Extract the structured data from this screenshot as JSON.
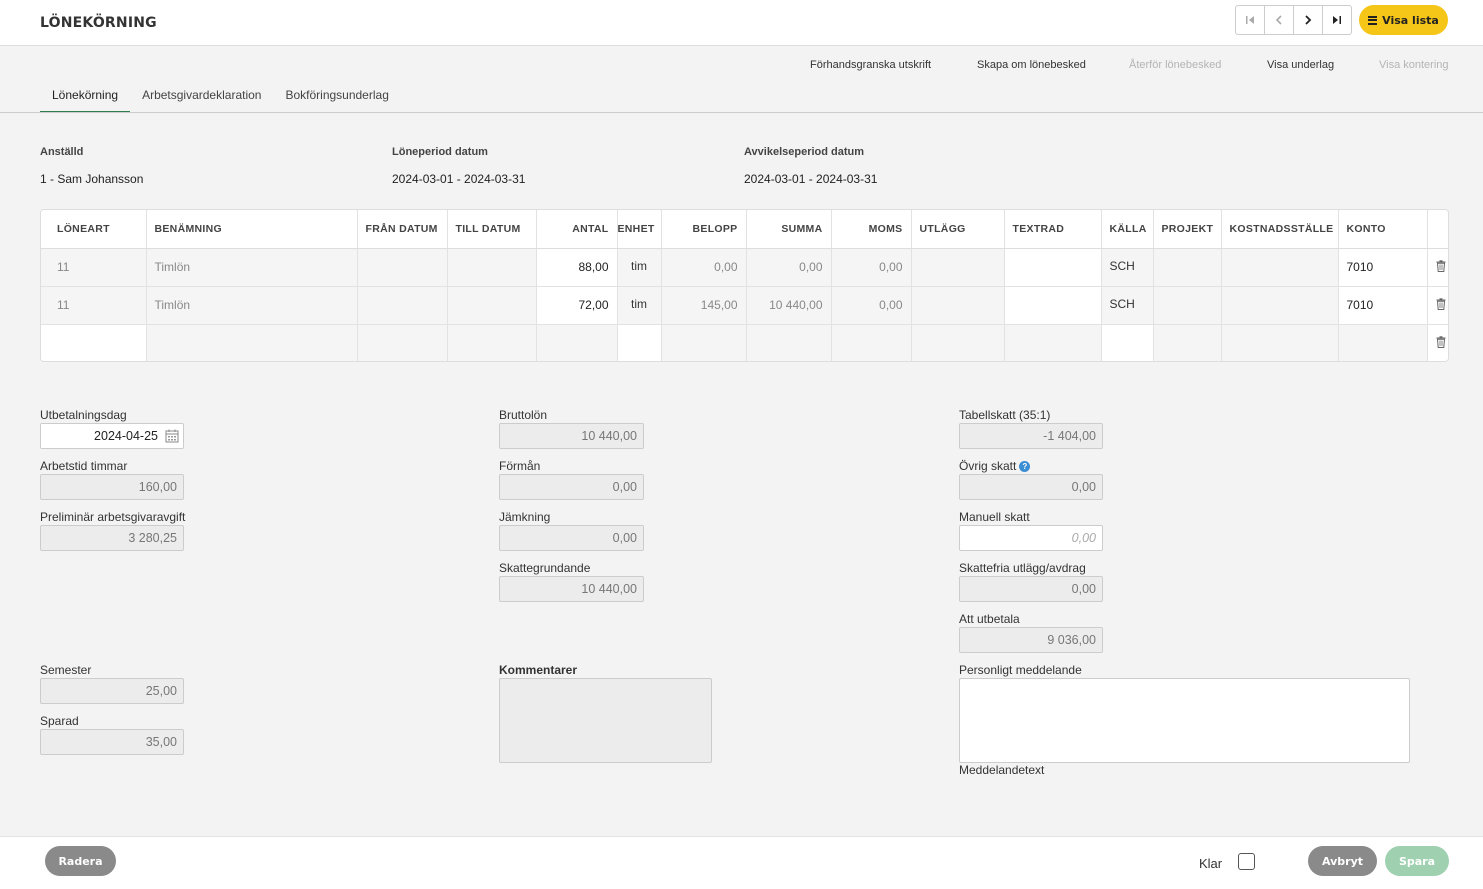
{
  "header": {
    "title": "LÖNEKÖRNING",
    "visa_lista": "Visa lista"
  },
  "actions": {
    "preview": "Förhandsgranska utskrift",
    "recreate": "Skapa om lönebesked",
    "revert": "Återför lönebesked",
    "show_basis": "Visa underlag",
    "show_posting": "Visa kontering"
  },
  "tabs": [
    "Lönekörning",
    "Arbetsgivardeklaration",
    "Bokföringsunderlag"
  ],
  "info": {
    "employee_label": "Anställd",
    "employee_value": "1 - Sam Johansson",
    "period_label": "Löneperiod datum",
    "period_value": "2024-03-01 - 2024-03-31",
    "deviation_label": "Avvikelseperiod datum",
    "deviation_value": "2024-03-01 - 2024-03-31"
  },
  "grid": {
    "headers": [
      "LÖNEART",
      "BENÄMNING",
      "FRÅN DATUM",
      "TILL DATUM",
      "ANTAL",
      "ENHET",
      "BELOPP",
      "SUMMA",
      "MOMS",
      "UTLÄGG",
      "TEXTRAD",
      "KÄLLA",
      "PROJEKT",
      "KOSTNADSSTÄLLE",
      "KONTO"
    ],
    "rows": [
      {
        "loneart": "11",
        "benamning": "Timlön",
        "fran": "",
        "till": "",
        "antal": "88,00",
        "enhet": "tim",
        "belopp": "0,00",
        "summa": "0,00",
        "moms": "0,00",
        "utlagg": "",
        "textrad": "",
        "kalla": "SCH",
        "projekt": "",
        "kostnadsstalle": "",
        "konto": "7010"
      },
      {
        "loneart": "11",
        "benamning": "Timlön",
        "fran": "",
        "till": "",
        "antal": "72,00",
        "enhet": "tim",
        "belopp": "145,00",
        "summa": "10 440,00",
        "moms": "0,00",
        "utlagg": "",
        "textrad": "",
        "kalla": "SCH",
        "projekt": "",
        "kostnadsstalle": "",
        "konto": "7010"
      }
    ]
  },
  "fields": {
    "utbetalningsdag_label": "Utbetalningsdag",
    "utbetalningsdag": "2024-04-25",
    "arbetstid_label": "Arbetstid timmar",
    "arbetstid": "160,00",
    "prelarb_label": "Preliminär arbetsgivaravgift",
    "prelarb": "3 280,25",
    "bruttolon_label": "Bruttolön",
    "bruttolon": "10 440,00",
    "forman_label": "Förmån",
    "forman": "0,00",
    "jamkning_label": "Jämkning",
    "jamkning": "0,00",
    "skattegrundande_label": "Skattegrundande",
    "skattegrundande": "10 440,00",
    "tabellskatt_label": "Tabellskatt (35:1)",
    "tabellskatt": "-1 404,00",
    "ovrig_label": "Övrig skatt",
    "ovrig": "0,00",
    "manuell_label": "Manuell skatt",
    "manuell_placeholder": "0,00",
    "skattefria_label": "Skattefria utlägg/avdrag",
    "skattefria": "0,00",
    "att_utbetala_label": "Att utbetala",
    "att_utbetala": "9 036,00",
    "semester_label": "Semester",
    "semester": "25,00",
    "sparad_label": "Sparad",
    "sparad": "35,00",
    "kommentarer_label": "Kommentarer",
    "personligt_label": "Personligt meddelande",
    "meddelande_label": "Meddelandetext"
  },
  "footer": {
    "radera": "Radera",
    "klar": "Klar",
    "avbryt": "Avbryt",
    "spara": "Spara"
  },
  "colors": {
    "accent_yellow": "#f5c518",
    "tab_active": "#2e7d4f",
    "button_gray": "#8a8a8a",
    "save_green": "#9fd0b0"
  }
}
